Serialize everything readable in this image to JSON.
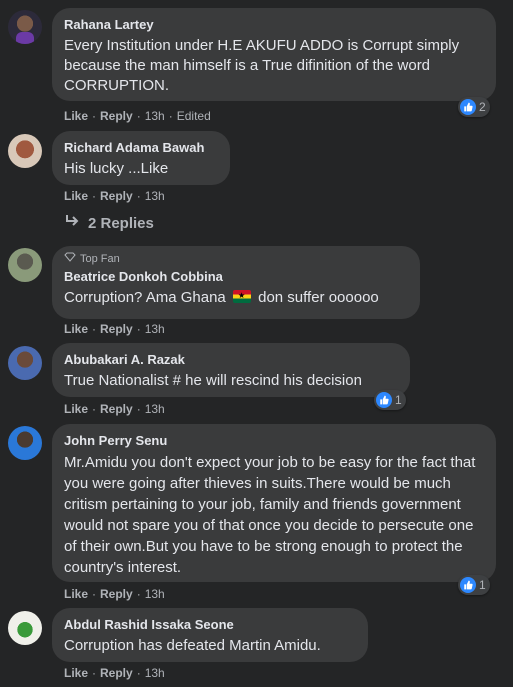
{
  "comments": [
    {
      "author": "Rahana Lartey",
      "text": "Every Institution under H.E AKUFU ADDO is Corrupt simply because the man himself is a True difinition of the word CORRUPTION.",
      "like": "Like",
      "reply": "Reply",
      "time": "13h",
      "edited": "Edited",
      "reactions": "2"
    },
    {
      "author": "Richard Adama Bawah",
      "text": "His lucky ...Like",
      "like": "Like",
      "reply": "Reply",
      "time": "13h"
    },
    {
      "badge": "Top Fan",
      "author": "Beatrice Donkoh Cobbina",
      "text_before": "Corruption? Ama Ghana",
      "text_after": "don suffer oooooo",
      "like": "Like",
      "reply": "Reply",
      "time": "13h"
    },
    {
      "author": "Abubakari A. Razak",
      "text": "True Nationalist # he will rescind his decision",
      "like": "Like",
      "reply": "Reply",
      "time": "13h",
      "reactions": "1"
    },
    {
      "author": "John Perry Senu",
      "text": "Mr.Amidu you don't expect your job to be easy for the fact that you were going after thieves in suits.There would be much critism pertaining to your job, family and friends government would not spare you of that once you decide to persecute one of their own.But you have to be strong enough to protect the country's interest.",
      "like": "Like",
      "reply": "Reply",
      "time": "13h",
      "reactions": "1"
    },
    {
      "author": "Abdul Rashid Issaka Seone",
      "text": "Corruption has defeated Martin Amidu.",
      "like": "Like",
      "reply": "Reply",
      "time": "13h"
    }
  ],
  "replies_link": "2 Replies",
  "colors": {
    "background": "#242526",
    "bubble": "#3a3b3c",
    "like_blue": "#2d88ff",
    "muted": "#b0b3b8"
  }
}
